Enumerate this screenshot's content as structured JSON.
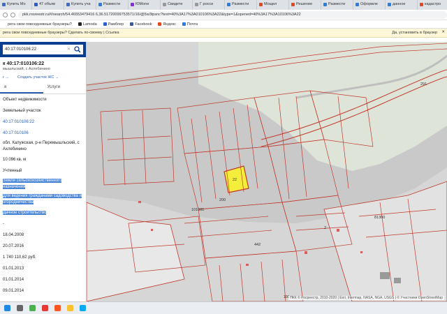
{
  "browser": {
    "tabs": [
      {
        "label": "Купить Мо",
        "color": "#3c6ec8"
      },
      {
        "label": "47 объяв",
        "color": "#2b5bd1"
      },
      {
        "label": "Купить уча",
        "color": "#3c6ec8"
      },
      {
        "label": "Размести",
        "color": "#2a7de1"
      },
      {
        "label": "ЮМоne",
        "color": "#8a2be2"
      },
      {
        "label": "Свидете",
        "color": "#999999"
      },
      {
        "label": "Г росси",
        "color": "#999999"
      },
      {
        "label": "Размести",
        "color": "#2a7de1"
      },
      {
        "label": "Мощел",
        "color": "#e04a1f"
      },
      {
        "label": "Решение",
        "color": "#e04a1f"
      },
      {
        "label": "Размести",
        "color": "#2a7de1"
      },
      {
        "label": "Оформле",
        "color": "#2a7de1"
      },
      {
        "label": "данное",
        "color": "#2a7de1"
      },
      {
        "label": "кадастро",
        "color": "#e04a1f"
      },
      {
        "label": "Публичн",
        "color": "#2a7de1"
      }
    ],
    "url": "pkk.rosreestr.ru/#/search/54.46553479416 6,36.51720099753571/16/@5w3tpsnc?text=40%3A17%3A010106%3A22&type=1&opened=40%3A17%3A10106%3A22",
    "bookmarks": [
      {
        "label": "рега свои повседневные браузеры?",
        "color": "#ffffff"
      },
      {
        "label": "Lamoda",
        "color": "#222222"
      },
      {
        "label": "Рамблер",
        "color": "#2b5bd1"
      },
      {
        "label": "Facebook",
        "color": "#3b5998"
      },
      {
        "label": "Яндекс",
        "color": "#e04a1f"
      },
      {
        "label": "Почта",
        "color": "#2a7de1"
      }
    ],
    "infobar": {
      "text": "рега свои повседневные браузеры?   Сделать по-своему | Ссылка",
      "right": "Да, установить в браузер"
    }
  },
  "panel": {
    "search_value": "40:17:010106:22",
    "title": "к 40:17:010106:22",
    "subtitle": "мышльский, с Ахлебинино",
    "link1": "г →",
    "link2": "Создать участок ЖС →",
    "tab_info": "я",
    "tab_services": "Услуги",
    "rows": [
      {
        "text": "Объект недвижимости",
        "kind": "plain"
      },
      {
        "text": "Земельный участок",
        "kind": "plain"
      },
      {
        "text": "40:17:010106:22",
        "kind": "link"
      },
      {
        "text": "40:17:010106",
        "kind": "link"
      },
      {
        "text": "обл. Калужская, р-н Перемышльский, с Ахлебинино",
        "kind": "tall"
      },
      {
        "text": "10 096 кв. м",
        "kind": "plain"
      },
      {
        "text": "Учтенный",
        "kind": "plain"
      },
      {
        "text": "Земли сельскохозяйственного назначения",
        "kind": "hltall"
      },
      {
        "text": "Для ведения гражданами садоводства и огородничества",
        "kind": "hltall"
      },
      {
        "text": "Дачное строительство",
        "kind": "hl"
      },
      {
        "text": "-",
        "kind": "plain"
      },
      {
        "text": "18.04.2008",
        "kind": "plain"
      },
      {
        "text": "20.07.2016",
        "kind": "plain"
      },
      {
        "text": "1 740 110,62 руб.",
        "kind": "plain"
      },
      {
        "text": "01.01.2013",
        "kind": "plain"
      },
      {
        "text": "01.01.2014",
        "kind": "plain"
      },
      {
        "text": "09.01.2014",
        "kind": "plain"
      }
    ]
  },
  "map": {
    "parcel_labels": [
      "22",
      "291",
      "81300",
      "200",
      "101081",
      "442",
      "2",
      "5"
    ],
    "attribution": "ПКК © Росреестр, 2010-2020 | Esri, Intermap, NASA, NGA, USGS | © Участники OpenStreetMap",
    "scale": "100 м",
    "highlight_color": "#f4ee3a"
  },
  "taskbar": {
    "apps": [
      {
        "name": "start",
        "color": "#1e88e5"
      },
      {
        "name": "search",
        "color": "#666666"
      },
      {
        "name": "chrome",
        "color": "#4caf50"
      },
      {
        "name": "opera",
        "color": "#e53935"
      },
      {
        "name": "yandex",
        "color": "#ff5722"
      },
      {
        "name": "explorer",
        "color": "#fbc02d"
      },
      {
        "name": "skype",
        "color": "#03a9f4"
      }
    ]
  }
}
